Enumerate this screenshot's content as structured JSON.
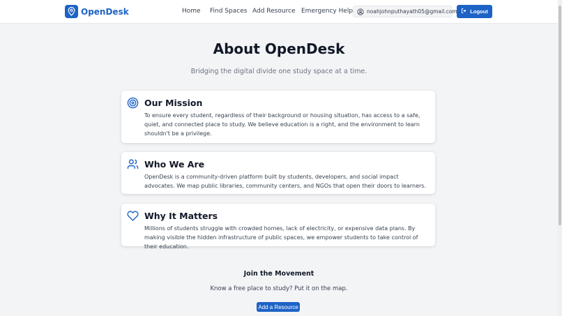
{
  "colors": {
    "accent": "#1d63c6",
    "background": "#f3f4f6"
  },
  "navbar": {
    "brand": "OpenDesk",
    "brand_icon": "map-pin-icon",
    "links": [
      "Home",
      "Find Spaces",
      "Add Resource",
      "Emergency Help"
    ],
    "user_email": "noahjohnputhayath05@gmail.com",
    "logout_label": "Logout"
  },
  "page": {
    "title": "About OpenDesk",
    "subtitle": "Bridging the digital divide one study space at a time."
  },
  "cards": [
    {
      "icon": "target-icon",
      "title": "Our Mission",
      "body": "To ensure every student, regardless of their background or housing situation, has access to a safe, quiet, and connected place to study. We believe education is a right, and the environment to learn shouldn't be a privilege."
    },
    {
      "icon": "users-icon",
      "title": "Who We Are",
      "body": "OpenDesk is a community-driven platform built by students, developers, and social impact advocates. We map public libraries, community centers, and NGOs that open their doors to learners."
    },
    {
      "icon": "heart-icon",
      "title": "Why It Matters",
      "body": "Millions of students struggle with crowded homes, lack of electricity, or expensive data plans. By making visible the hidden infrastructure of public spaces, we empower students to take control of their education."
    }
  ],
  "join": {
    "title": "Join the Movement",
    "text": "Know a free place to study? Put it on the map.",
    "button_label": "Add a Resource"
  }
}
